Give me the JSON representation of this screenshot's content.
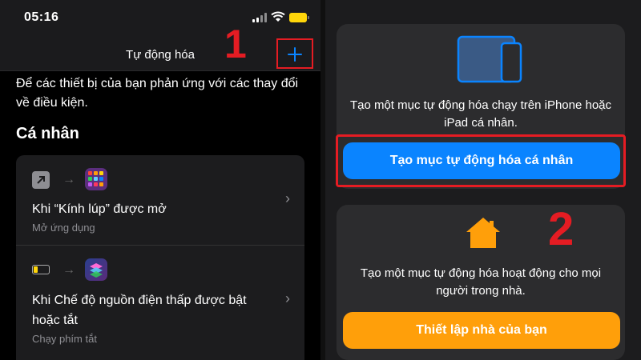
{
  "status_bar": {
    "time": "05:16"
  },
  "nav": {
    "title": "Tự động hóa"
  },
  "left": {
    "description": "Để các thiết bị của bạn phản ứng với các thay đổi về điều kiện.",
    "section_title": "Cá nhân",
    "automations": [
      {
        "title": "Khi “Kính lúp” được mở",
        "subtitle": "Mở ứng dụng"
      },
      {
        "title": "Khi Chế độ nguồn điện thấp được bật hoặc tắt",
        "subtitle": "Chạy phím tắt"
      }
    ]
  },
  "right": {
    "personal_desc": "Tạo một mục tự động hóa chạy trên iPhone hoặc iPad cá nhân.",
    "personal_button": "Tạo mục tự động hóa cá nhân",
    "home_desc": "Tạo một mục tự động hóa hoạt động cho mọi người trong nhà.",
    "home_button": "Thiết lập nhà của bạn"
  },
  "annotations": {
    "step1": "1",
    "step2": "2"
  },
  "colors": {
    "accent_blue": "#0a84ff",
    "accent_orange": "#ff9f0a",
    "highlight_red": "#e51c23",
    "battery_yellow": "#ffd60a"
  },
  "icons": [
    "signal-icon",
    "wifi-icon",
    "battery-icon",
    "plus-icon",
    "share-arrow-icon",
    "app-grid-icon",
    "shortcuts-icon",
    "low-battery-icon",
    "chevron-right-icon",
    "ipad-iphone-icon",
    "home-icon"
  ]
}
